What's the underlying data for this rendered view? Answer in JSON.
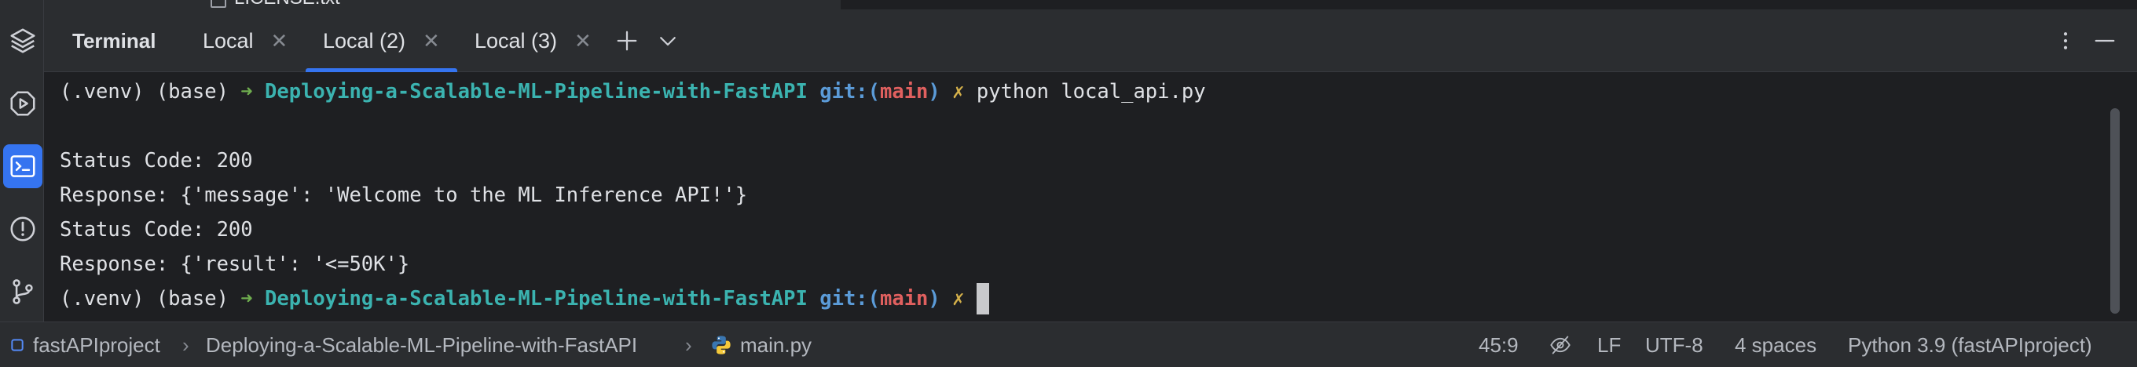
{
  "peek": {
    "file_label": "LICENSE.txt"
  },
  "tabbar": {
    "title": "Terminal",
    "tabs": [
      {
        "label": "Local"
      },
      {
        "label": "Local (2)"
      },
      {
        "label": "Local (3)"
      }
    ]
  },
  "terminal": {
    "lines": [
      {
        "venv": "(.venv) (base) ",
        "arrow": "➜",
        "dir": "Deploying-a-Scalable-ML-Pipeline-with-FastAPI",
        "git": "git:(",
        "branch": "main",
        "git_close": ")",
        "mark": "✗",
        "command": "python local_api.py"
      },
      {
        "text": ""
      },
      {
        "text": "Status Code: 200"
      },
      {
        "text": "Response: {'message': 'Welcome to the ML Inference API!'}"
      },
      {
        "text": "Status Code: 200"
      },
      {
        "text": "Response: {'result': '<=50K'}"
      },
      {
        "venv": "(.venv) (base) ",
        "arrow": "➜",
        "dir": "Deploying-a-Scalable-ML-Pipeline-with-FastAPI",
        "git": "git:(",
        "branch": "main",
        "git_close": ")",
        "mark": "✗",
        "command": ""
      }
    ]
  },
  "statusbar": {
    "project": "fastAPIproject",
    "folder": "Deploying-a-Scalable-ML-Pipeline-with-FastAPI",
    "file": "main.py",
    "caret": "45:9",
    "line_ending": "LF",
    "encoding": "UTF-8",
    "indent": "4 spaces",
    "interpreter": "Python 3.9 (fastAPIproject)"
  },
  "colors": {
    "accent": "#3574f0",
    "prompt_arrow": "#6fae4f",
    "directory": "#3bb3b0",
    "git": "#5b9bd8",
    "branch": "#e0605f",
    "dirty_mark": "#d4b04a"
  },
  "icons": {
    "strip": [
      "layers-icon",
      "run-icon",
      "terminal-icon",
      "problems-icon",
      "git-icon"
    ],
    "tabbar": [
      "add-tab-icon",
      "chevron-down-icon",
      "more-vertical-icon",
      "minimize-icon"
    ],
    "status": [
      "project-icon",
      "python-icon",
      "no-inspections-icon"
    ]
  }
}
